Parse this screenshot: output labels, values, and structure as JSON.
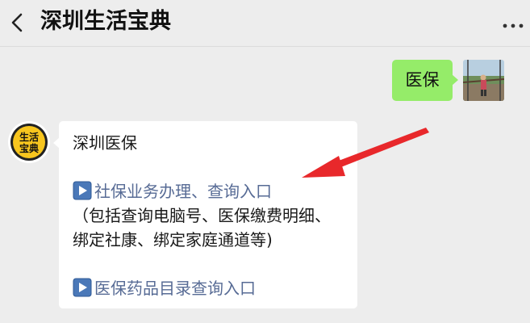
{
  "header": {
    "title": "深圳生活宝典",
    "back_icon": "chevron-left-icon",
    "more_icon": "more-dots-icon"
  },
  "messages": {
    "user": {
      "text": "医保",
      "bubble_color": "#95ec69"
    },
    "bot": {
      "avatar_text_top": "生活",
      "avatar_text_bottom": "宝典",
      "avatar_color": "#f7c51e",
      "heading": "深圳医保",
      "link1": "社保业务办理、查询入口",
      "note_line1": "（包括查询电脑号、医保缴费明细、",
      "note_line2": "绑定社康、绑定家庭通道等)",
      "link2": "医保药品目录查询入口",
      "link_color": "#576b95",
      "play_icon_color": "#4a78b8"
    }
  },
  "annotation": {
    "arrow_color": "#e8282b"
  }
}
